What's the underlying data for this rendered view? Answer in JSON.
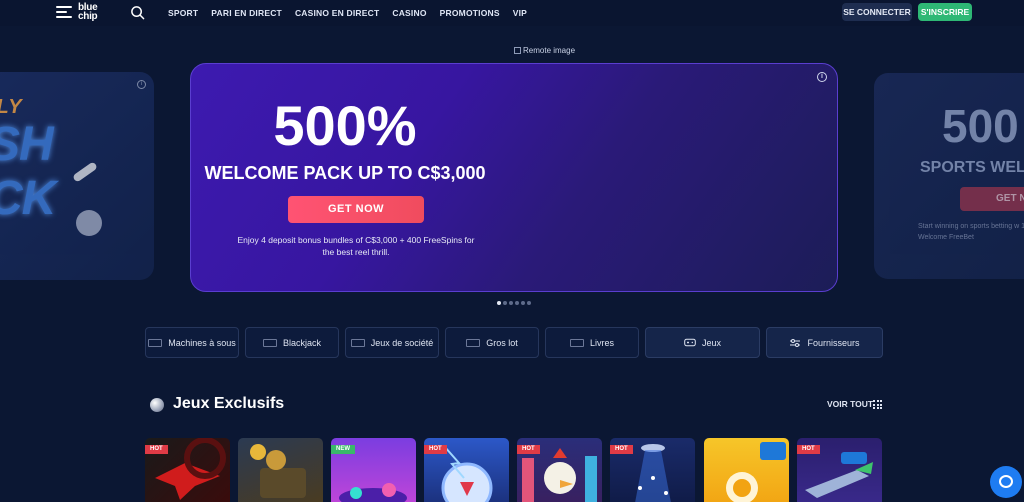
{
  "header": {
    "logo_top": "blue",
    "logo_bottom": "chip",
    "nav": [
      "SPORT",
      "PARI EN DIRECT",
      "CASINO EN DIRECT",
      "CASINO",
      "PROMOTIONS",
      "VIP"
    ],
    "login_label": "SE CONNECTER",
    "signup_label": "S'INSCRIRE"
  },
  "remote_image_alt": "Remote image",
  "carousel": {
    "left": {
      "line1": "ILY",
      "line2": "SH",
      "line3": "CK"
    },
    "main": {
      "headline": "500%",
      "subheadline": "WELCOME PACK UP TO C$3,000",
      "cta": "GET NOW",
      "description": "Enjoy 4 deposit bonus bundles of C$3,000 + 400 FreeSpins for the best reel thrill."
    },
    "right": {
      "headline": "500",
      "subheadline": "SPORTS WELC",
      "cta": "GET N",
      "description": "Start winning on sports betting w 100% more Welcome FreeBet"
    },
    "dots_count": 6,
    "active_dot": 0
  },
  "categories": [
    {
      "label": "Machines à sous",
      "icon": "slots-icon"
    },
    {
      "label": "Blackjack",
      "icon": "blackjack-icon"
    },
    {
      "label": "Jeux de société",
      "icon": "table-games-icon"
    },
    {
      "label": "Gros lot",
      "icon": "jackpot-icon"
    },
    {
      "label": "Livres",
      "icon": "books-icon"
    },
    {
      "label": "Jeux",
      "icon": "gamepad-icon"
    },
    {
      "label": "Fournisseurs",
      "icon": "sliders-icon"
    }
  ],
  "section": {
    "title": "Jeux Exclusifs",
    "see_all": "VOIR TOUT"
  },
  "games": [
    {
      "badge": "HOT"
    },
    {
      "badge": ""
    },
    {
      "badge": "NEW"
    },
    {
      "badge": "HOT"
    },
    {
      "badge": "HOT"
    },
    {
      "badge": "HOT"
    },
    {
      "badge": ""
    },
    {
      "badge": "HOT"
    }
  ],
  "colors": {
    "background": "#0b1733",
    "signup": "#2eb875",
    "cta": "#ff5373",
    "hot_badge": "#e03b46",
    "new_badge": "#39b86a",
    "chat": "#1e7cf2"
  }
}
